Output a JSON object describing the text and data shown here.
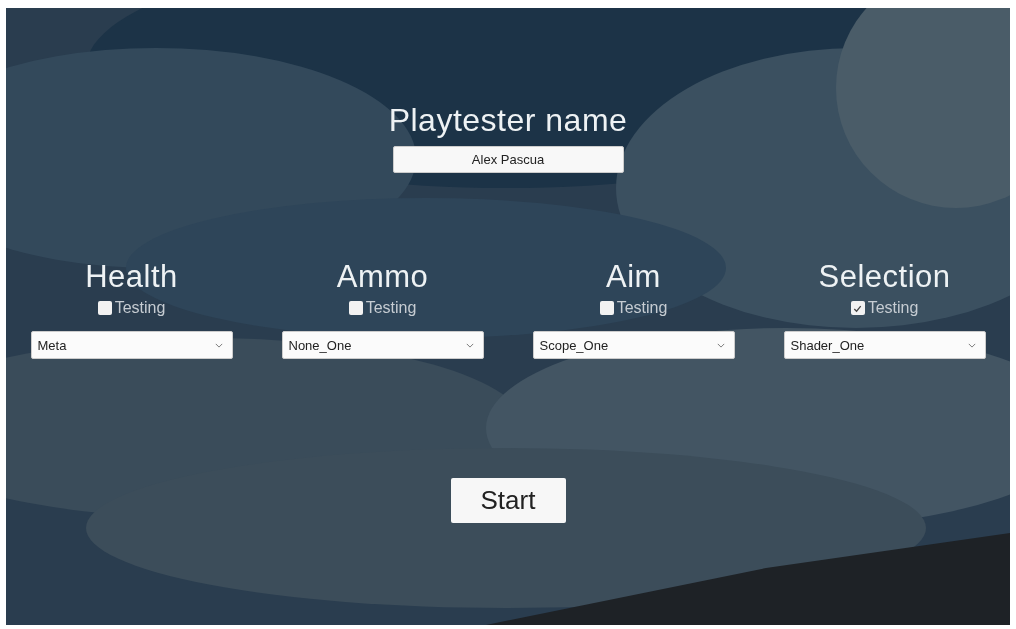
{
  "title": "Playtester name",
  "name_field": {
    "value": "Alex Pascua"
  },
  "categories": [
    {
      "heading": "Health",
      "checkbox_label": "Testing",
      "checked": false,
      "dropdown_value": "Meta"
    },
    {
      "heading": "Ammo",
      "checkbox_label": "Testing",
      "checked": false,
      "dropdown_value": "None_One"
    },
    {
      "heading": "Aim",
      "checkbox_label": "Testing",
      "checked": false,
      "dropdown_value": "Scope_One"
    },
    {
      "heading": "Selection",
      "checkbox_label": "Testing",
      "checked": true,
      "dropdown_value": "Shader_One"
    }
  ],
  "start_button": "Start"
}
